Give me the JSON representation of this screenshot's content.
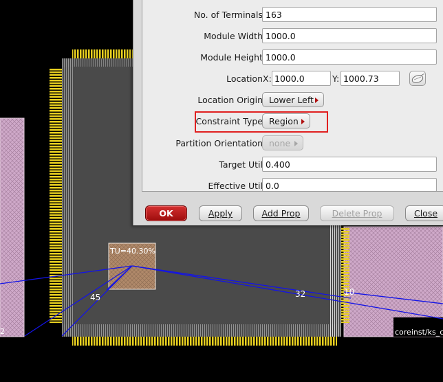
{
  "layout_view": {
    "instance_label": "TU=40.30%",
    "net_weights": [
      "45",
      "32",
      "10"
    ],
    "right_instance_label": "coreinst/ks_c",
    "left_instance_label": "2",
    "colors": {
      "background": "#000000",
      "module_fill": "#4a4a4a",
      "pin_color": "#e8d020",
      "region_color": "#b08a6a",
      "net_color": "#1414e6"
    }
  },
  "dialog": {
    "fields": {
      "num_terminals": {
        "label": "No. of Terminals",
        "value": "163"
      },
      "module_width": {
        "label": "Module Width",
        "value": "1000.0"
      },
      "module_height": {
        "label": "Module Height",
        "value": "1000.0"
      },
      "location": {
        "label": "Location",
        "x_label": "X:",
        "x_value": "1000.0",
        "y_label": "Y:",
        "y_value": "1000.73",
        "pick_icon": "mouse-icon"
      },
      "location_origin": {
        "label": "Location Origin",
        "value": "Lower Left"
      },
      "constraint_type": {
        "label": "Constraint Type",
        "value": "Region"
      },
      "partition_orientation": {
        "label": "Partition Orientation",
        "value": "none"
      },
      "target_util": {
        "label": "Target Util",
        "value": "0.400"
      },
      "effective_util": {
        "label": "Effective Util",
        "value": "0.0"
      }
    },
    "buttons": {
      "ok": "OK",
      "apply": "Apply",
      "add_prop": "Add Prop",
      "delete_prop": "Delete Prop",
      "close": "Close"
    },
    "highlight_color": "#e02020"
  }
}
